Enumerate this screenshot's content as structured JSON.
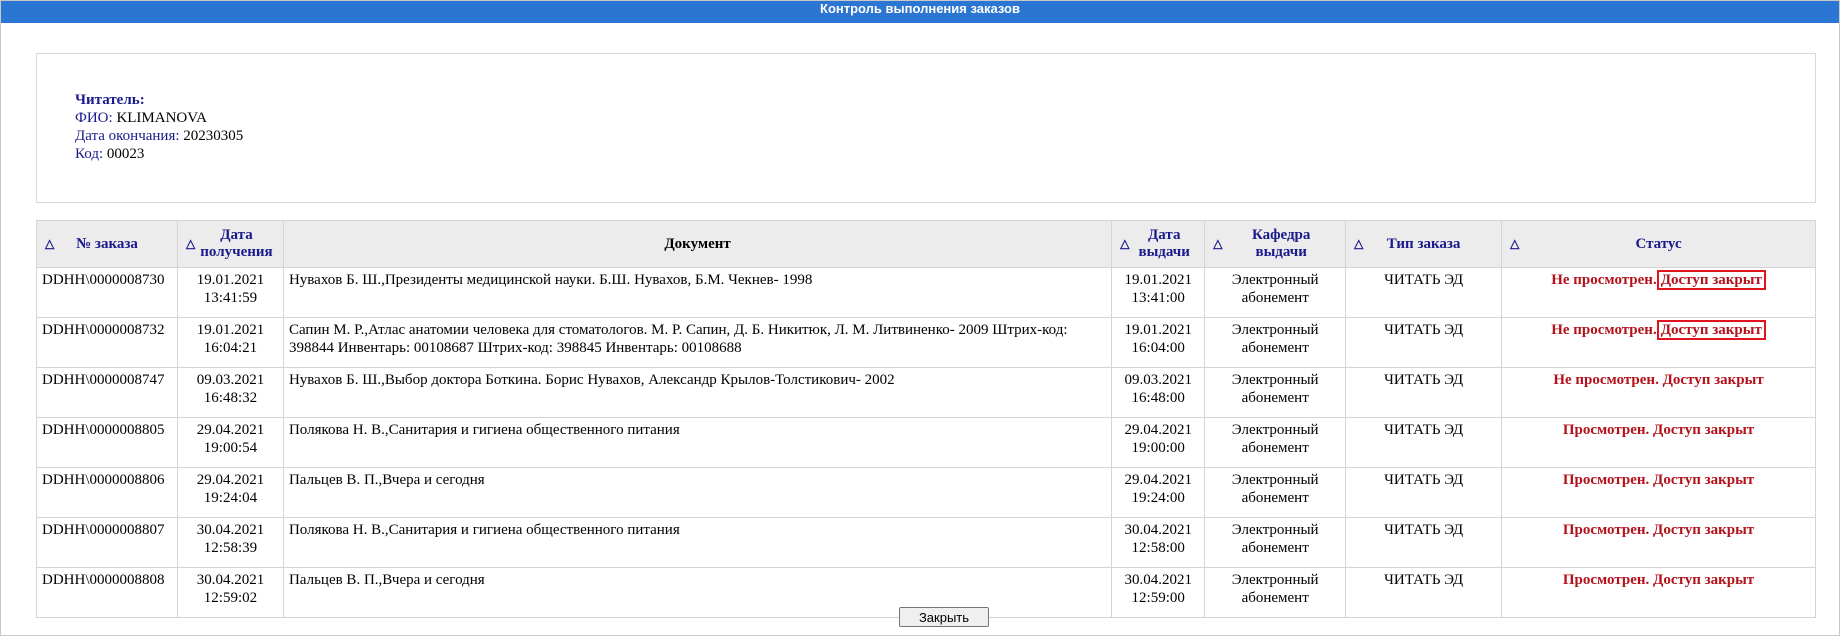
{
  "window": {
    "title": "Контроль выполнения заказов"
  },
  "reader": {
    "heading": "Читатель:",
    "fio_label": "ФИО:",
    "fio_value": "KLIMANOVA",
    "end_label": "Дата окончания:",
    "end_value": "20230305",
    "code_label": "Код:",
    "code_value": "00023"
  },
  "table": {
    "sort_icon": "△",
    "headers": {
      "order_no": "№ заказа",
      "received_1": "Дата",
      "received_2": "получения",
      "document": "Документ",
      "issued_1": "Дата",
      "issued_2": "выдачи",
      "dept_1": "Кафедра",
      "dept_2": "выдачи",
      "type": "Тип заказа",
      "status": "Статус"
    },
    "rows": [
      {
        "order_no": "DDHH\\0000008730",
        "received_date": "19.01.2021",
        "received_time": "13:41:59",
        "document": "Нувахов Б. Ш.,Президенты медицинской науки. Б.Ш. Нувахов, Б.М. Чекнев- 1998",
        "issued_date": "19.01.2021",
        "issued_time": "13:41:00",
        "dept_1": "Электронный",
        "dept_2": "абонемент",
        "type": "ЧИТАТЬ ЭД",
        "status_view": "Не просмотрен.",
        "status_access": "Доступ закрыт"
      },
      {
        "order_no": "DDHH\\0000008732",
        "received_date": "19.01.2021",
        "received_time": "16:04:21",
        "document": "Сапин М. Р.,Атлас анатомии человека для стоматологов. М. Р. Сапин, Д. Б. Никитюк, Л. М. Литвиненко- 2009 Штрих-код: 398844 Инвентарь: 00108687 Штрих-код: 398845 Инвентарь: 00108688",
        "issued_date": "19.01.2021",
        "issued_time": "16:04:00",
        "dept_1": "Электронный",
        "dept_2": "абонемент",
        "type": "ЧИТАТЬ ЭД",
        "status_view": "Не просмотрен.",
        "status_access": "Доступ закрыт"
      },
      {
        "order_no": "DDHH\\0000008747",
        "received_date": "09.03.2021",
        "received_time": "16:48:32",
        "document": "Нувахов Б. Ш.,Выбор доктора Боткина. Борис Нувахов, Александр Крылов-Толстикович- 2002",
        "issued_date": "09.03.2021",
        "issued_time": "16:48:00",
        "dept_1": "Электронный",
        "dept_2": "абонемент",
        "type": "ЧИТАТЬ ЭД",
        "status_view": "Не просмотрен.",
        "status_access": "Доступ закрыт"
      },
      {
        "order_no": "DDHH\\0000008805",
        "received_date": "29.04.2021",
        "received_time": "19:00:54",
        "document": "Полякова Н. В.,Санитария и гигиена общественного питания",
        "issued_date": "29.04.2021",
        "issued_time": "19:00:00",
        "dept_1": "Электронный",
        "dept_2": "абонемент",
        "type": "ЧИТАТЬ ЭД",
        "status_view": "Просмотрен.",
        "status_access": "Доступ закрыт"
      },
      {
        "order_no": "DDHH\\0000008806",
        "received_date": "29.04.2021",
        "received_time": "19:24:04",
        "document": "Пальцев В. П.,Вчера и сегодня",
        "issued_date": "29.04.2021",
        "issued_time": "19:24:00",
        "dept_1": "Электронный",
        "dept_2": "абонемент",
        "type": "ЧИТАТЬ ЭД",
        "status_view": "Просмотрен.",
        "status_access": "Доступ закрыт"
      },
      {
        "order_no": "DDHH\\0000008807",
        "received_date": "30.04.2021",
        "received_time": "12:58:39",
        "document": "Полякова Н. В.,Санитария и гигиена общественного питания",
        "issued_date": "30.04.2021",
        "issued_time": "12:58:00",
        "dept_1": "Электронный",
        "dept_2": "абонемент",
        "type": "ЧИТАТЬ ЭД",
        "status_view": "Просмотрен.",
        "status_access": "Доступ закрыт"
      },
      {
        "order_no": "DDHH\\0000008808",
        "received_date": "30.04.2021",
        "received_time": "12:59:02",
        "document": "Пальцев В. П.,Вчера и сегодня",
        "issued_date": "30.04.2021",
        "issued_time": "12:59:00",
        "dept_1": "Электронный",
        "dept_2": "абонемент",
        "type": "ЧИТАТЬ ЭД",
        "status_view": "Просмотрен.",
        "status_access": "Доступ закрыт"
      }
    ]
  },
  "footer": {
    "close_label": "Закрыть"
  },
  "colors": {
    "titlebar": "#2b76d2",
    "status": "#b3121b",
    "highlight_box": "#e0141e",
    "label": "#1a1a8c"
  }
}
